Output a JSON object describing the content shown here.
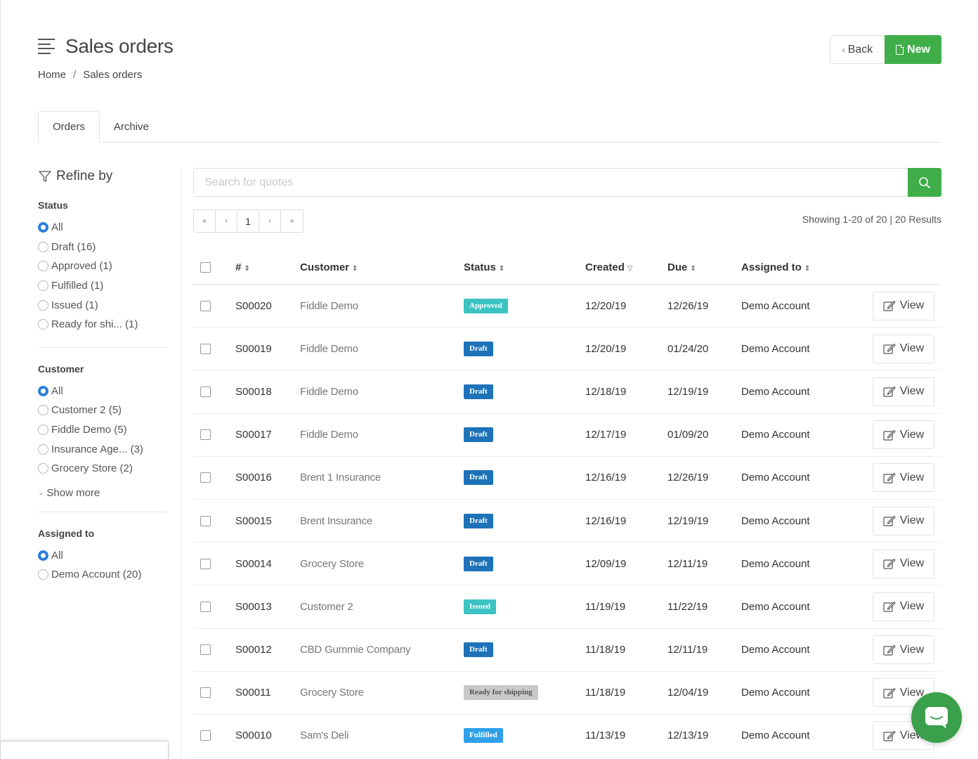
{
  "header": {
    "title": "Sales orders",
    "back_label": "Back",
    "new_label": "New"
  },
  "breadcrumb": {
    "home": "Home",
    "separator": "/",
    "current": "Sales orders"
  },
  "tabs": [
    "Orders",
    "Archive"
  ],
  "sidebar": {
    "refine_label": "Refine by",
    "groups": [
      {
        "title": "Status",
        "options": [
          {
            "label": "All",
            "selected": true
          },
          {
            "label": "Draft (16)",
            "selected": false
          },
          {
            "label": "Approved (1)",
            "selected": false
          },
          {
            "label": "Fulfilled (1)",
            "selected": false
          },
          {
            "label": "Issued (1)",
            "selected": false
          },
          {
            "label": "Ready for shi... (1)",
            "selected": false
          }
        ]
      },
      {
        "title": "Customer",
        "options": [
          {
            "label": "All",
            "selected": true
          },
          {
            "label": "Customer 2 (5)",
            "selected": false
          },
          {
            "label": "Fiddle Demo (5)",
            "selected": false
          },
          {
            "label": "Insurance Age... (3)",
            "selected": false
          },
          {
            "label": "Grocery Store (2)",
            "selected": false
          }
        ],
        "show_more": "Show more"
      },
      {
        "title": "Assigned to",
        "options": [
          {
            "label": "All",
            "selected": true
          },
          {
            "label": "Demo Account (20)",
            "selected": false
          }
        ]
      }
    ]
  },
  "search": {
    "placeholder": "Search for quotes",
    "value": ""
  },
  "pagination": {
    "first": "«",
    "prev": "‹",
    "current": "1",
    "next": "›",
    "last": "»"
  },
  "results_text": "Showing 1-20 of 20 | 20 Results",
  "table": {
    "headers": [
      "#",
      "Customer",
      "Status",
      "Created",
      "Due",
      "Assigned to"
    ],
    "view_label": "View",
    "rows": [
      {
        "num": "S00020",
        "customer": "Fiddle Demo",
        "status": "Approved",
        "created": "12/20/19",
        "due": "12/26/19",
        "assigned": "Demo Account"
      },
      {
        "num": "S00019",
        "customer": "Fiddle Demo",
        "status": "Draft",
        "created": "12/20/19",
        "due": "01/24/20",
        "assigned": "Demo Account"
      },
      {
        "num": "S00018",
        "customer": "Fiddle Demo",
        "status": "Draft",
        "created": "12/18/19",
        "due": "12/19/19",
        "assigned": "Demo Account"
      },
      {
        "num": "S00017",
        "customer": "Fiddle Demo",
        "status": "Draft",
        "created": "12/17/19",
        "due": "01/09/20",
        "assigned": "Demo Account"
      },
      {
        "num": "S00016",
        "customer": "Brent 1 Insurance",
        "status": "Draft",
        "created": "12/16/19",
        "due": "12/26/19",
        "assigned": "Demo Account"
      },
      {
        "num": "S00015",
        "customer": "Brent Insurance",
        "status": "Draft",
        "created": "12/16/19",
        "due": "12/19/19",
        "assigned": "Demo Account"
      },
      {
        "num": "S00014",
        "customer": "Grocery Store",
        "status": "Draft",
        "created": "12/09/19",
        "due": "12/11/19",
        "assigned": "Demo Account"
      },
      {
        "num": "S00013",
        "customer": "Customer 2",
        "status": "Issued",
        "created": "11/19/19",
        "due": "11/22/19",
        "assigned": "Demo Account"
      },
      {
        "num": "S00012",
        "customer": "CBD Gummie Company",
        "status": "Draft",
        "created": "11/18/19",
        "due": "12/11/19",
        "assigned": "Demo Account"
      },
      {
        "num": "S00011",
        "customer": "Grocery Store",
        "status": "Ready for shipping",
        "created": "11/18/19",
        "due": "12/04/19",
        "assigned": "Demo Account"
      },
      {
        "num": "S00010",
        "customer": "Sam's Deli",
        "status": "Fulfilled",
        "created": "11/13/19",
        "due": "12/13/19",
        "assigned": "Demo Account"
      }
    ]
  },
  "colors": {
    "primary_green": "#3fae49",
    "radio_blue": "#2d7fd8",
    "status_approved": "#3cc2c2",
    "status_draft": "#1d72b8",
    "status_issued": "#3cc2c2",
    "status_ready": "#c9c9c9",
    "status_fulfilled": "#2fa0ea"
  },
  "icons": [
    "menu-icon",
    "chevron-left-icon",
    "document-icon",
    "funnel-icon",
    "search-icon",
    "edit-icon",
    "chat-icon"
  ]
}
